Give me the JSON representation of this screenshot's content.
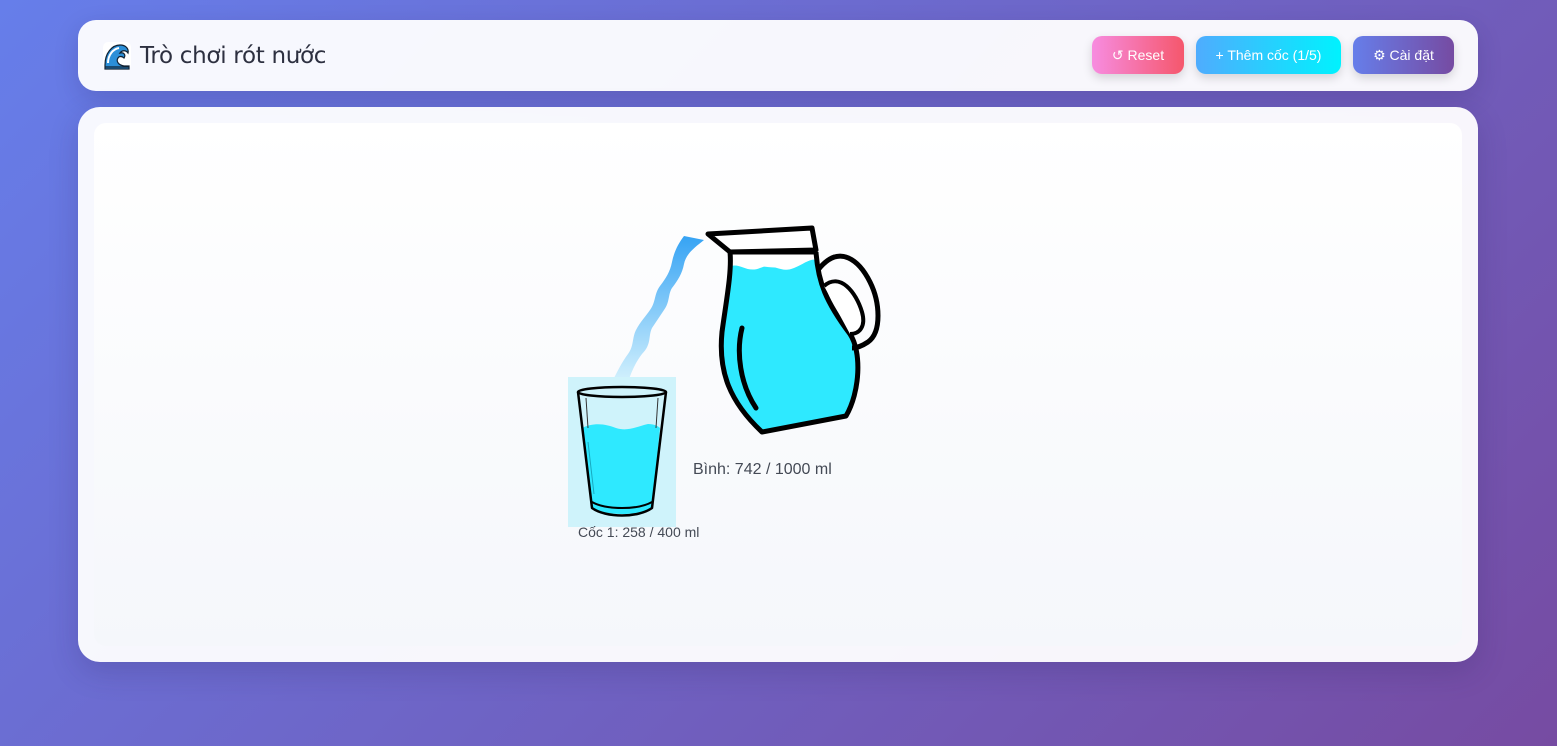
{
  "header": {
    "title": "Trò chơi rót nước",
    "title_icon": "wave-icon",
    "buttons": {
      "reset": "↺ Reset",
      "add_cup": "+ Thêm cốc (1/5)",
      "settings": "⚙ Cài đặt"
    }
  },
  "game": {
    "pitcher_label": "Bình: 742 / 1000 ml",
    "cups": [
      {
        "label": "Cốc 1: 258 / 400 ml"
      }
    ]
  },
  "colors": {
    "water": "#2ee9ff",
    "stream_top": "#3aa8f5",
    "stream_bottom": "#cdeffd",
    "background_start": "#667eea",
    "background_end": "#764ba2"
  }
}
